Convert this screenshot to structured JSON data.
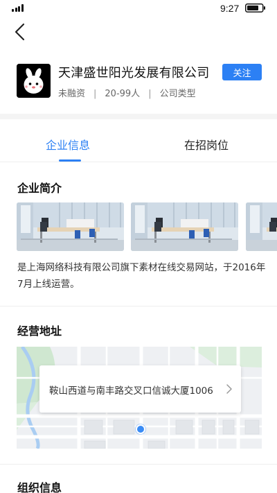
{
  "status_bar": {
    "time": "9:27"
  },
  "company": {
    "name": "天津盛世阳光发展有限公司",
    "follow_label": "关注",
    "funding": "未融资",
    "size": "20-99人",
    "type": "公司类型",
    "separator": "|"
  },
  "tabs": [
    {
      "label": "企业信息",
      "active": true
    },
    {
      "label": "在招岗位",
      "active": false
    }
  ],
  "intro": {
    "title": "企业简介",
    "text": "是上海网络科技有限公司旗下素材在线交易网站，于2016年7月上线运营。"
  },
  "address": {
    "title": "经营地址",
    "text": "鞍山西道与南丰路交叉口信诚大厦1006"
  },
  "org": {
    "title": "组织信息"
  },
  "colors": {
    "accent": "#2c80f4",
    "pin": "#3a8cf5"
  },
  "icons": [
    "signal-icon",
    "battery-icon",
    "back-arrow-icon",
    "chevron-right-icon",
    "location-pin-icon"
  ]
}
